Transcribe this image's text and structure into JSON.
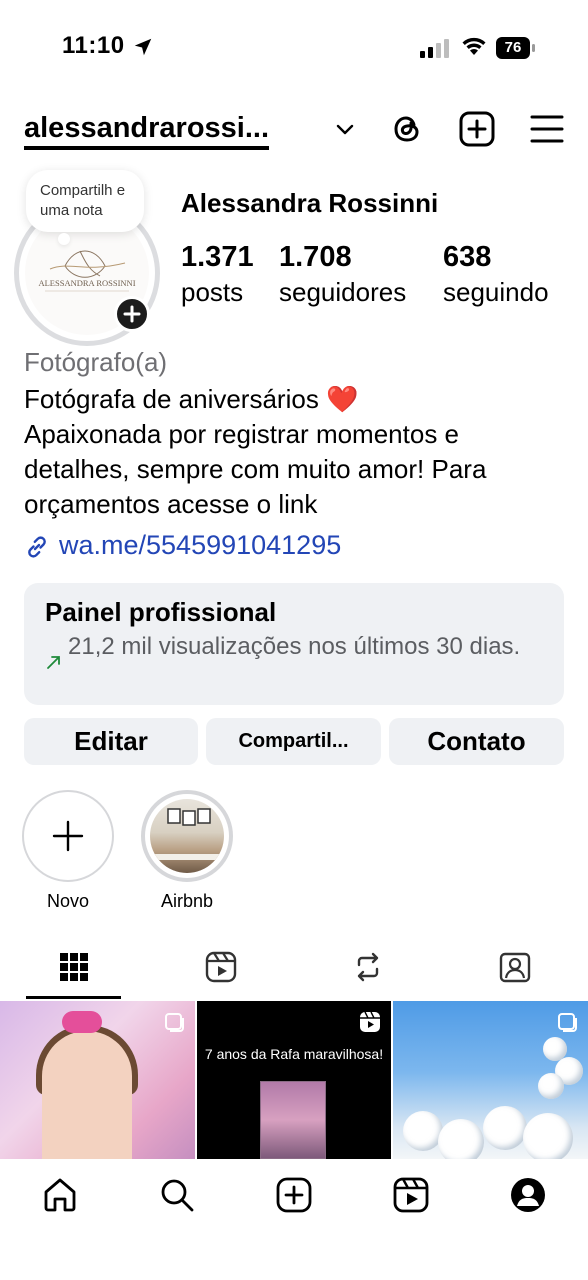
{
  "status_bar": {
    "time": "11:10",
    "battery": "76"
  },
  "header": {
    "username": "alessandrarossi...",
    "icons": [
      "chevron-down-icon",
      "threads-icon",
      "create-icon",
      "menu-icon"
    ]
  },
  "profile": {
    "note": "Compartilh e uma nota",
    "display_name": "Alessandra Rossinni",
    "avatar_logo_text": "ALESSANDRA ROSSINNI",
    "stats": {
      "posts_count": "1.371",
      "posts_label": "posts",
      "followers_count": "1.708",
      "followers_label": "seguidores",
      "following_count": "638",
      "following_label": "seguindo"
    },
    "category": "Fotógrafo(a)",
    "bio_line1": "Fotógrafa de aniversários",
    "bio_emoji": "❤️",
    "bio_rest": "Apaixonada por registrar momentos e detalhes, sempre com muito amor! Para orçamentos acesse o link",
    "link": "wa.me/5545991041295"
  },
  "dashboard": {
    "title": "Painel profissional",
    "subtitle": "21,2 mil visualizações nos últimos 30 dias."
  },
  "buttons": {
    "edit": "Editar",
    "share": "Compartil...",
    "contact": "Contato"
  },
  "highlights": [
    {
      "label": "Novo"
    },
    {
      "label": "Airbnb"
    }
  ],
  "tabs": [
    "grid-tab",
    "reels-tab",
    "reposts-tab",
    "tagged-tab"
  ],
  "posts": [
    {
      "type": "carousel"
    },
    {
      "type": "reel",
      "text": "7 anos da Rafa maravilhosa!"
    },
    {
      "type": "carousel"
    }
  ],
  "bottom_nav": [
    "home-icon",
    "search-icon",
    "create-icon",
    "reels-icon",
    "profile-icon"
  ]
}
